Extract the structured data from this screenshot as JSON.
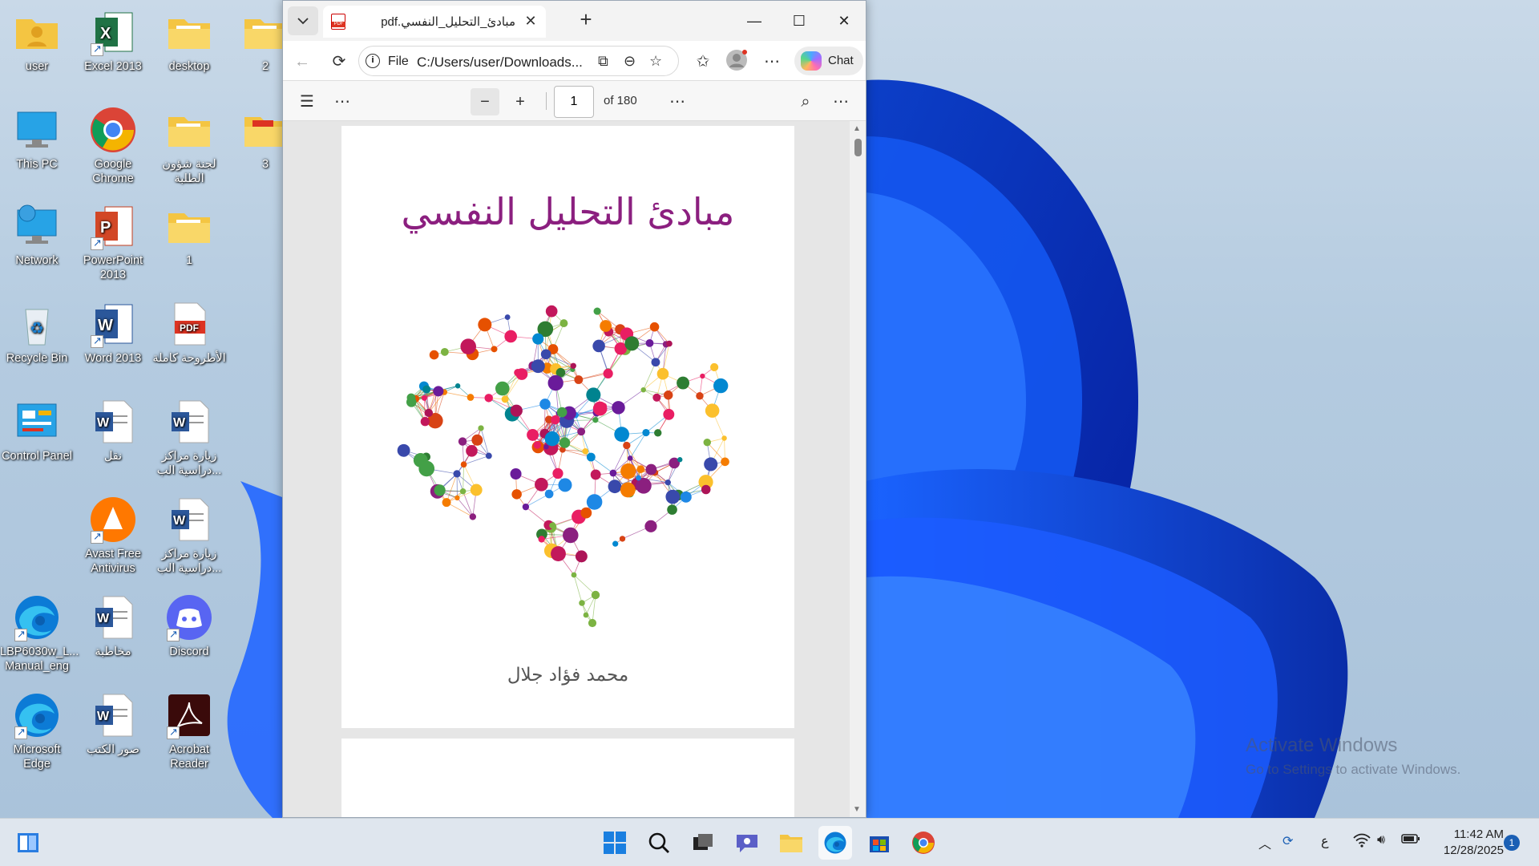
{
  "desktop": {
    "icons": [
      {
        "label": "user"
      },
      {
        "label": "Excel 2013"
      },
      {
        "label": "desktop"
      },
      {
        "label": "2"
      },
      {
        "label": "This PC"
      },
      {
        "label": "Google Chrome"
      },
      {
        "label": "لجنة شؤون الطلبة"
      },
      {
        "label": "3"
      },
      {
        "label": "Network"
      },
      {
        "label": "PowerPoint 2013"
      },
      {
        "label": "1"
      },
      {
        "label": "Recycle Bin"
      },
      {
        "label": "Word 2013"
      },
      {
        "label": "الأطروحة كاملة"
      },
      {
        "label": "Control Panel"
      },
      {
        "label": "نقل"
      },
      {
        "label": "زيارة مراكز دراسية الب..."
      },
      {
        "label": "Avast Free Antivirus"
      },
      {
        "label": "زيارة مراكز دراسية الب..."
      },
      {
        "label": "LBP6030w_L... Manual_eng"
      },
      {
        "label": "مخاطبة"
      },
      {
        "label": "Discord"
      },
      {
        "label": "Microsoft Edge"
      },
      {
        "label": "صور الكتب"
      },
      {
        "label": "Acrobat Reader"
      }
    ],
    "watermark": {
      "line1": "Activate Windows",
      "line2": "Go to Settings to activate Windows."
    }
  },
  "browser": {
    "tab": {
      "title": "pdf.مبادئ_التحليل_النفسي"
    },
    "address": {
      "scheme": "File",
      "url": "C:/Users/user/Downloads..."
    },
    "chat_label": "Chat",
    "pdf_toolbar": {
      "page": "1",
      "page_count": "of 180"
    },
    "document": {
      "title": "مبادئ التحليل النفسي",
      "author": "محمد فؤاد جلال"
    }
  },
  "taskbar": {
    "clock_time": "11:42 AM",
    "clock_date": "12/28/2025",
    "input_lang": "ع",
    "notification_count": "1"
  },
  "colors": {
    "title_purple": "#8b1f7f",
    "accent_blue": "#1a5fb4"
  }
}
